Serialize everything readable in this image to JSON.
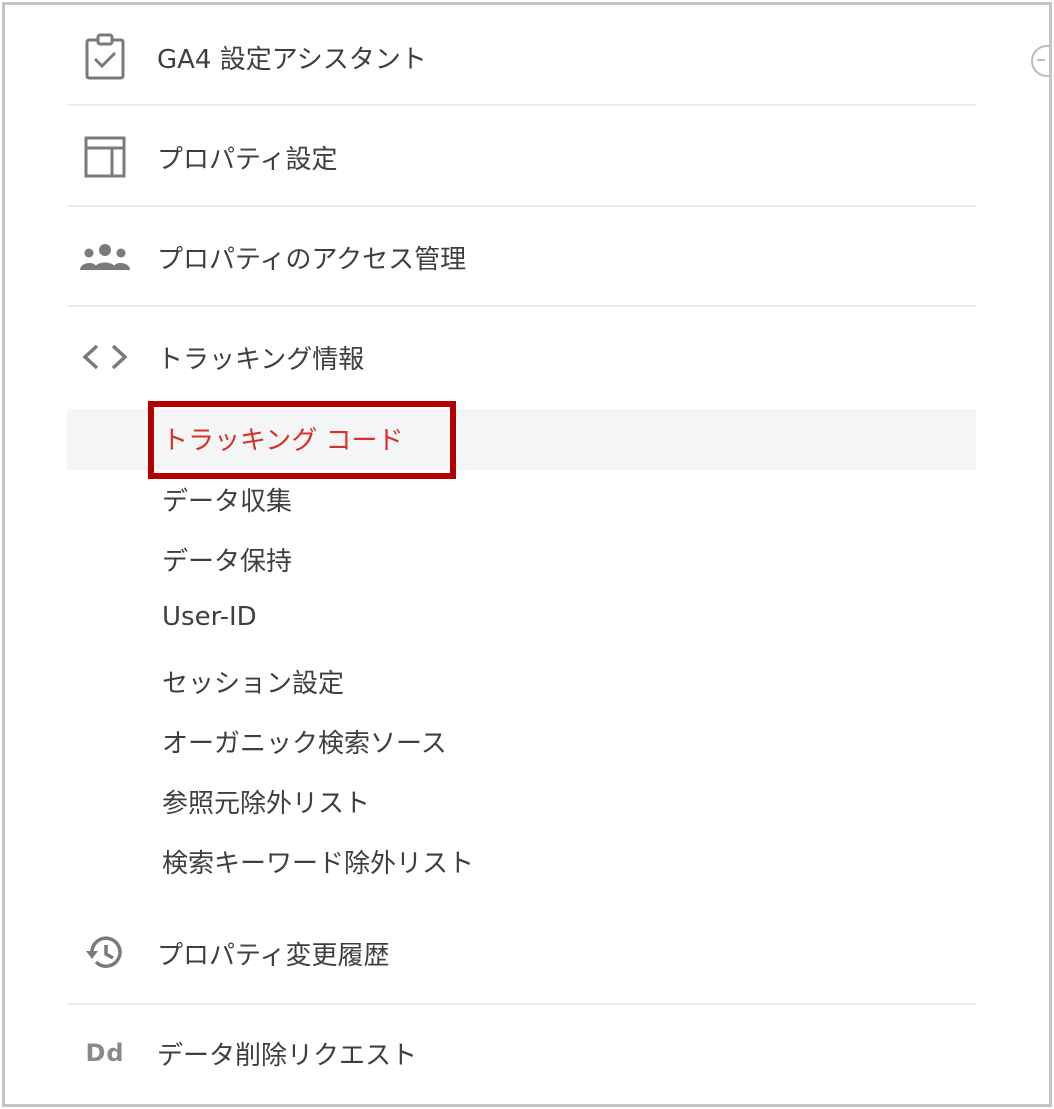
{
  "menu": {
    "items": [
      {
        "id": "ga4",
        "label": "GA4 設定アシスタント",
        "icon": "clipboard-check-icon"
      },
      {
        "id": "property-settings",
        "label": "プロパティ設定",
        "icon": "layout-icon"
      },
      {
        "id": "property-access",
        "label": "プロパティのアクセス管理",
        "icon": "people-icon"
      },
      {
        "id": "tracking-info",
        "label": "トラッキング情報",
        "icon": "code-brackets-icon"
      },
      {
        "id": "property-history",
        "label": "プロパティ変更履歴",
        "icon": "history-icon"
      },
      {
        "id": "data-deletion",
        "label": "データ削除リクエスト",
        "icon": "dd-text-icon",
        "icon_text": "Dd"
      }
    ],
    "tracking_submenu": [
      {
        "label": "トラッキング コード",
        "active": true
      },
      {
        "label": "データ収集",
        "active": false
      },
      {
        "label": "データ保持",
        "active": false
      },
      {
        "label": "User-ID",
        "active": false
      },
      {
        "label": "セッション設定",
        "active": false
      },
      {
        "label": "オーガニック検索ソース",
        "active": false
      },
      {
        "label": "参照元除外リスト",
        "active": false
      },
      {
        "label": "検索キーワード除外リスト",
        "active": false
      }
    ]
  },
  "colors": {
    "active_text": "#d93025",
    "highlight_box": "#b30000",
    "icon_gray": "#7a7a7a",
    "text": "#3c4043"
  }
}
